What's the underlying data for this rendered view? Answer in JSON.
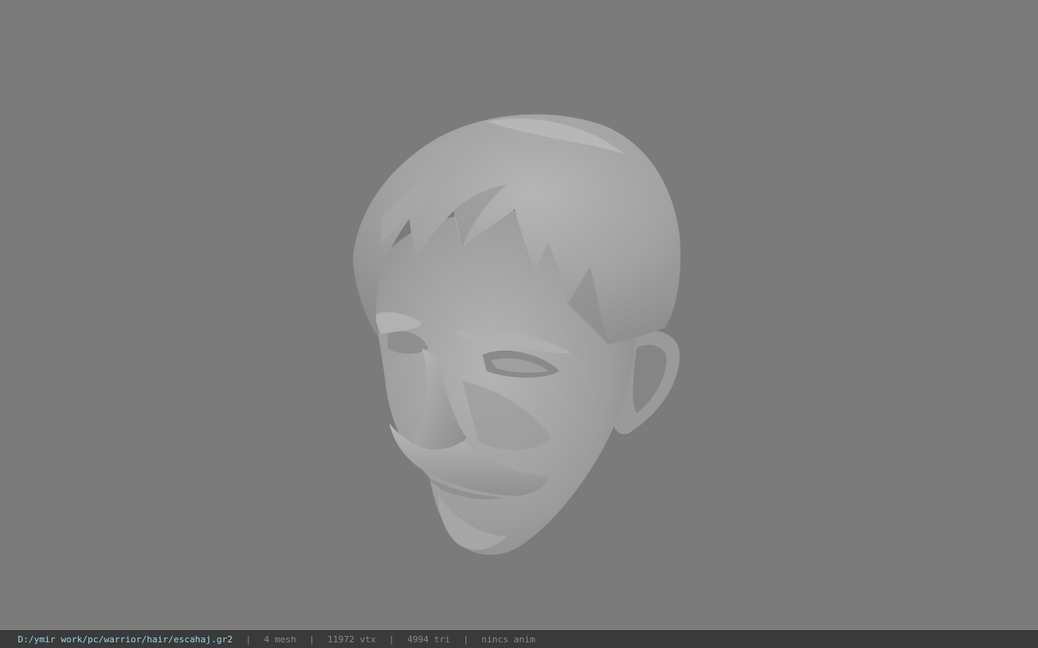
{
  "viewport": {
    "background_color": "#7b7b7b",
    "model_shade_color": "#a4a4a4"
  },
  "statusbar": {
    "file_path": "D:/ymir work/pc/warrior/hair/escahaj.gr2",
    "separator": "|",
    "mesh_count": "4 mesh",
    "vertex_count": "11972 vtx",
    "triangle_count": "4994 tri",
    "anim_status": "nincs anim",
    "path_color": "#9fd3e8",
    "text_color": "#8a8a8a",
    "background_color": "#3a3a3a"
  }
}
